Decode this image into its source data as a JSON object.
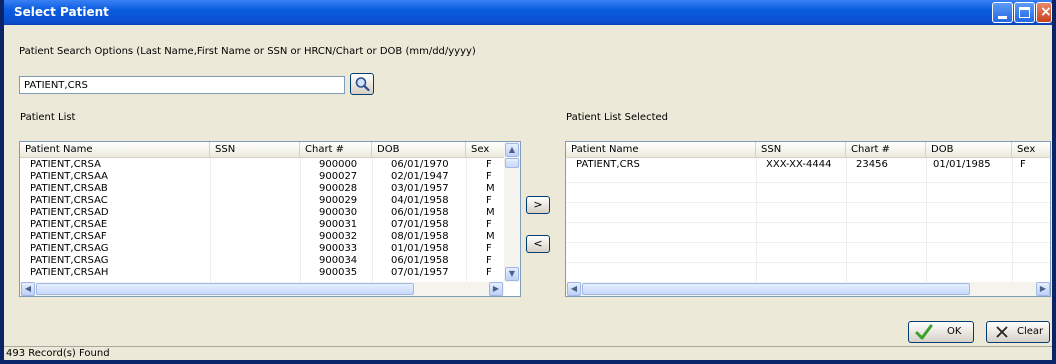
{
  "window": {
    "title": "Select Patient"
  },
  "search": {
    "options_label": "Patient Search Options (Last Name,First Name or SSN or HRCN/Chart or DOB (mm/dd/yyyy)",
    "value": "PATIENT,CRS",
    "search_icon": "magnifier-icon"
  },
  "patient_list": {
    "label": "Patient List",
    "columns": [
      "Patient Name",
      "SSN",
      "Chart #",
      "DOB",
      "Sex"
    ],
    "rows": [
      [
        "PATIENT,CRSA",
        "",
        "900000",
        "06/01/1970",
        "F"
      ],
      [
        "PATIENT,CRSAA",
        "",
        "900027",
        "02/01/1947",
        "F"
      ],
      [
        "PATIENT,CRSAB",
        "",
        "900028",
        "03/01/1957",
        "M"
      ],
      [
        "PATIENT,CRSAC",
        "",
        "900029",
        "04/01/1958",
        "F"
      ],
      [
        "PATIENT,CRSAD",
        "",
        "900030",
        "06/01/1958",
        "M"
      ],
      [
        "PATIENT,CRSAE",
        "",
        "900031",
        "07/01/1958",
        "F"
      ],
      [
        "PATIENT,CRSAF",
        "",
        "900032",
        "08/01/1958",
        "M"
      ],
      [
        "PATIENT,CRSAG",
        "",
        "900033",
        "01/01/1958",
        "F"
      ],
      [
        "PATIENT,CRSAG",
        "",
        "900034",
        "06/01/1958",
        "F"
      ],
      [
        "PATIENT,CRSAH",
        "",
        "900035",
        "07/01/1957",
        "F"
      ]
    ]
  },
  "selected_list": {
    "label": "Patient List Selected",
    "columns": [
      "Patient Name",
      "SSN",
      "Chart #",
      "DOB",
      "Sex"
    ],
    "rows": [
      [
        "PATIENT,CRS",
        "XXX-XX-4444",
        "23456",
        "01/01/1985",
        "F"
      ]
    ]
  },
  "move": {
    "add_label": ">",
    "remove_label": "<"
  },
  "buttons": {
    "ok_label": "OK",
    "clear_label": "Clear",
    "ok_icon": "checkmark-icon",
    "clear_icon": "x-icon"
  },
  "status": {
    "text": "493 Record(s) Found"
  },
  "colors": {
    "title_bar": "#0a5ce0",
    "window_bg": "#ece9d8",
    "ok_check": "#3aa12a"
  }
}
